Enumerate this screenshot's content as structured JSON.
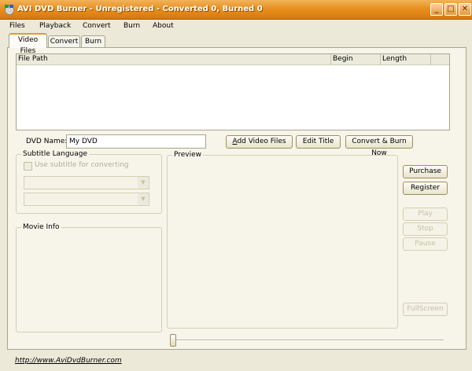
{
  "window": {
    "title": "AVI DVD Burner - Unregistered - Converted 0, Burned 0",
    "controls": {
      "minimize": "_",
      "maximize": "□",
      "close": "✕"
    }
  },
  "menu": {
    "files": "Files",
    "playback": "Playback",
    "convert": "Convert",
    "burn": "Burn",
    "about": "About"
  },
  "tabs": {
    "video_files": "Video Files",
    "convert": "Convert",
    "burn": "Burn"
  },
  "file_list": {
    "columns": {
      "file_path": "File Path",
      "begin": "Begin",
      "length": "Length"
    }
  },
  "dvd_name": {
    "label": "DVD Name:",
    "value": "My DVD"
  },
  "buttons": {
    "add_video_files_prefix": "A",
    "add_video_files_rest": "dd Video Files",
    "edit_title": "Edit Title",
    "convert_burn_now": "Convert & Burn Now",
    "purchase": "Purchase",
    "register": "Register",
    "play": "Play",
    "stop": "Stop",
    "pause": "Pause",
    "fullscreen": "FullScreen"
  },
  "subtitle": {
    "group_title": "Subtitle Language",
    "checkbox_label": "Use subtitle for converting"
  },
  "movie_info": {
    "group_title": "Movie Info"
  },
  "preview": {
    "group_title": "Preview"
  },
  "status": {
    "url": "http://www.AviDvdBurner.com"
  },
  "colors": {
    "title_bar": "#e8901f",
    "active_tab_accent": "#e69a2d",
    "window_bg": "#ece9d8"
  },
  "icons": {
    "app": "dvd-burner-app-icon",
    "combo_arrow": "chevron-down-icon"
  }
}
